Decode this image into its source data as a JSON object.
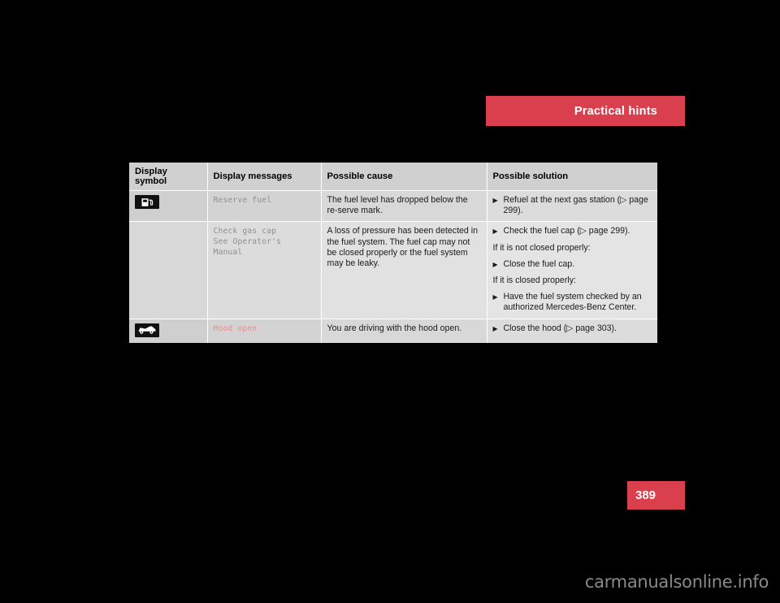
{
  "header": {
    "banner_label": "Practical hints",
    "banner_color": "#d93f4c"
  },
  "table": {
    "columns": [
      {
        "key": "symbol",
        "label": "Display symbol"
      },
      {
        "key": "message",
        "label": "Display messages"
      },
      {
        "key": "cause",
        "label": "Possible cause"
      },
      {
        "key": "solution",
        "label": "Possible solution"
      }
    ],
    "rows": [
      {
        "symbol_icon": "fuel-pump-icon",
        "message": "Reserve fuel",
        "message_color": "#8f8f8f",
        "cause": "The fuel level has dropped below the re-serve mark.",
        "solution": [
          {
            "type": "bullet",
            "text": "Refuel at the next gas station (▷ page 299)."
          }
        ]
      },
      {
        "symbol_icon": "",
        "message": "Check gas cap\nSee Operator's Manual",
        "message_color": "#8f8f8f",
        "cause": "A loss of pressure has been detected in the fuel system. The fuel cap may not be closed properly or the fuel system may be leaky.",
        "solution": [
          {
            "type": "bullet",
            "text": "Check the fuel cap (▷ page 299)."
          },
          {
            "type": "note",
            "text": "If it is not closed properly:"
          },
          {
            "type": "bullet",
            "text": "Close the fuel cap."
          },
          {
            "type": "note",
            "text": "If it is closed properly:"
          },
          {
            "type": "bullet",
            "text": "Have the fuel system checked by an authorized Mercedes-Benz Center."
          }
        ]
      },
      {
        "symbol_icon": "hood-open-icon",
        "message": "Hood open",
        "message_color": "#f08a8a",
        "cause": "You are driving with the hood open.",
        "solution": [
          {
            "type": "bullet",
            "text": "Close the hood (▷ page 303)."
          }
        ]
      }
    ]
  },
  "footer": {
    "page_number": "389",
    "page_tab_color": "#d93f4c",
    "watermark": "carmanualsonline.info"
  }
}
